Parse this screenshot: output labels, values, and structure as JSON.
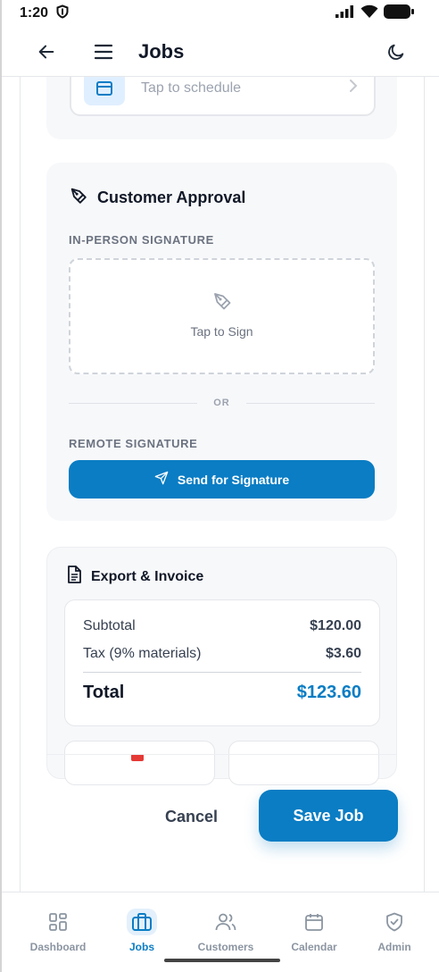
{
  "status_bar": {
    "time": "1:20"
  },
  "app_bar": {
    "title": "Jobs"
  },
  "schedule": {
    "placeholder": "Tap to schedule"
  },
  "customer_approval": {
    "title": "Customer Approval",
    "in_person_label": "IN-PERSON SIGNATURE",
    "tap_to_sign": "Tap to Sign",
    "or_text": "OR",
    "remote_label": "REMOTE SIGNATURE",
    "send_button": "Send for Signature"
  },
  "export": {
    "title": "Export & Invoice",
    "subtotal_label": "Subtotal",
    "subtotal_value": "$120.00",
    "tax_label": "Tax (9% materials)",
    "tax_value": "$3.60",
    "total_label": "Total",
    "total_value": "$123.60"
  },
  "actions": {
    "cancel": "Cancel",
    "save": "Save Job"
  },
  "nav": {
    "items": [
      {
        "label": "Dashboard",
        "icon": "grid-icon"
      },
      {
        "label": "Jobs",
        "icon": "briefcase-icon",
        "active": true
      },
      {
        "label": "Customers",
        "icon": "users-icon"
      },
      {
        "label": "Calendar",
        "icon": "calendar-icon"
      },
      {
        "label": "Admin",
        "icon": "shield-check-icon"
      }
    ]
  },
  "colors": {
    "primary": "#0a7dc4",
    "card_bg": "#f7f8fa",
    "muted_text": "#6b7280"
  }
}
